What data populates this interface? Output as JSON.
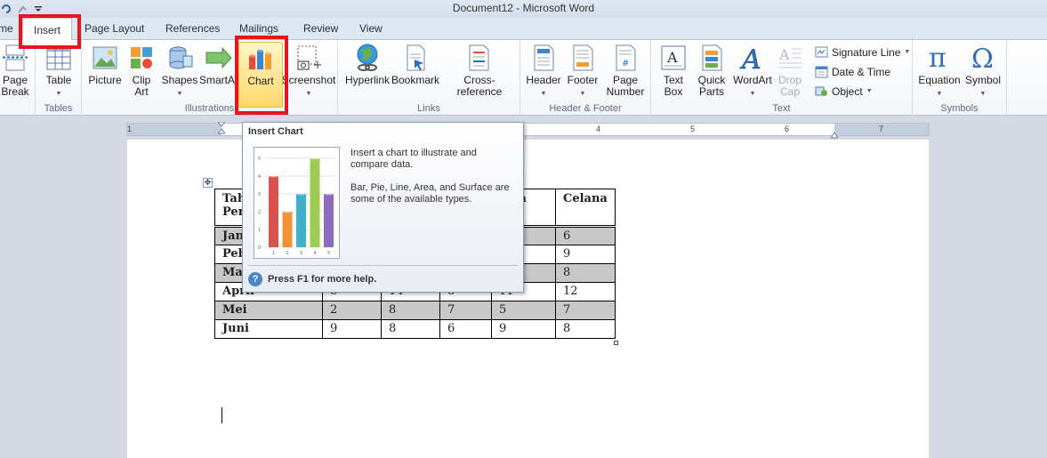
{
  "window": {
    "title": "Document12 - Microsoft Word"
  },
  "tabs": [
    {
      "label": "me"
    },
    {
      "label": "Insert"
    },
    {
      "label": "Page Layout"
    },
    {
      "label": "References"
    },
    {
      "label": "Mailings"
    },
    {
      "label": "Review"
    },
    {
      "label": "View"
    }
  ],
  "ribbon": {
    "pages": {
      "page_break": "Page\nBreak"
    },
    "tables": {
      "table": "Table",
      "label": "Tables"
    },
    "illustrations": {
      "picture": "Picture",
      "clip_art": "Clip\nArt",
      "shapes": "Shapes",
      "smartart": "SmartArt",
      "chart": "Chart",
      "screenshot": "Screenshot",
      "label": "Illustrations"
    },
    "links": {
      "hyperlink": "Hyperlink",
      "bookmark": "Bookmark",
      "cross_reference": "Cross-reference",
      "label": "Links"
    },
    "header_footer": {
      "header": "Header",
      "footer": "Footer",
      "page_number": "Page\nNumber",
      "label": "Header & Footer"
    },
    "text": {
      "text_box": "Text\nBox",
      "quick_parts": "Quick\nParts",
      "wordart": "WordArt",
      "drop_cap": "Drop\nCap",
      "signature_line": "Signature Line",
      "date_time": "Date & Time",
      "object": "Object",
      "label": "Text"
    },
    "symbols": {
      "equation": "Equation",
      "symbol": "Symbol",
      "label": "Symbols"
    }
  },
  "ruler": {
    "numbers": [
      "1",
      "4",
      "5",
      "6",
      "7"
    ]
  },
  "tooltip": {
    "title": "Insert Chart",
    "desc1": "Insert a chart to illustrate and compare data.",
    "desc2": "Bar, Pie, Line, Area, and Surface are some of the available types.",
    "help": "Press F1 for more help.",
    "thumb_values": [
      4,
      2,
      3,
      5,
      3
    ],
    "thumb_axis": [
      "0",
      "1",
      "2",
      "3",
      "4",
      "5"
    ],
    "thumb_x": [
      "1",
      "2",
      "3",
      "4",
      "5"
    ]
  },
  "table": {
    "header": [
      "Tah\nPer",
      "",
      "",
      "",
      "neja",
      "Celana"
    ],
    "rows": [
      [
        "Jan",
        "",
        "",
        "",
        "",
        "6"
      ],
      [
        "Peb",
        "",
        "",
        "",
        "",
        "9"
      ],
      [
        "Ma",
        "",
        "",
        "",
        "",
        "8"
      ],
      [
        "April",
        "8",
        "14",
        "8",
        "11",
        "12"
      ],
      [
        "Mei",
        "2",
        "8",
        "7",
        "5",
        "7"
      ],
      [
        "Juni",
        "9",
        "8",
        "6",
        "9",
        "8"
      ]
    ]
  },
  "colors": {
    "highlight_box": "#e8141c",
    "tab_bg": "#dde6f1",
    "chart_button_hover": "#ffd86b"
  }
}
